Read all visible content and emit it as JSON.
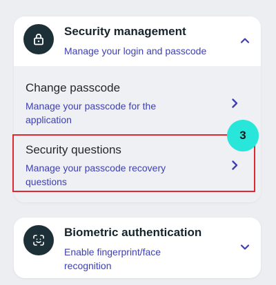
{
  "security_card": {
    "title": "Security management",
    "subtitle": "Manage your login and passcode",
    "icon": "lock-icon",
    "expanded": true,
    "items": [
      {
        "title": "Change passcode",
        "description": "Manage your passcode for the application"
      },
      {
        "title": "Security questions",
        "description": "Manage your passcode recovery questions"
      }
    ]
  },
  "biometric_card": {
    "title": "Biometric authentication",
    "subtitle": "Enable fingerprint/face recognition",
    "icon": "face-id-icon",
    "expanded": false
  },
  "annotation": {
    "step_number": "3",
    "highlight_color": "#e0272f",
    "badge_color": "#29e6da"
  },
  "colors": {
    "accent": "#3d3fb0",
    "icon_bg": "#1d3038",
    "background": "#eceef1"
  }
}
